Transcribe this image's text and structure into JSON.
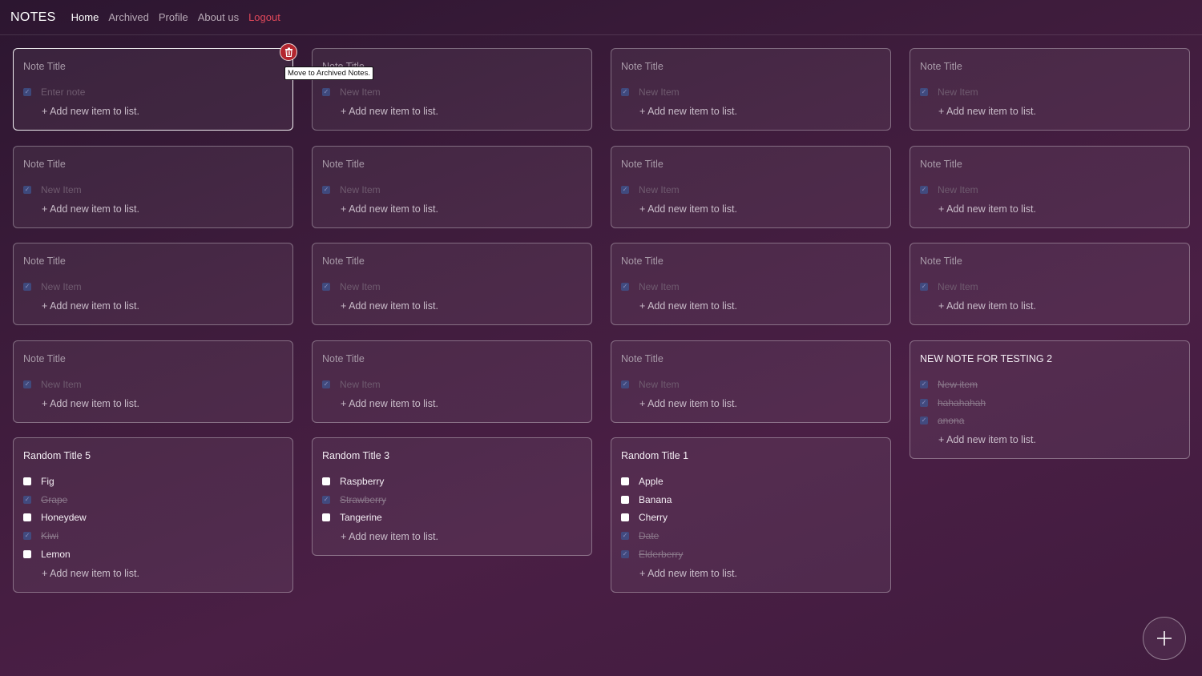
{
  "nav": {
    "brand": "NOTES",
    "links": [
      {
        "label": "Home",
        "active": true
      },
      {
        "label": "Archived"
      },
      {
        "label": "Profile"
      },
      {
        "label": "About us"
      },
      {
        "label": "Logout"
      }
    ]
  },
  "add_item_label": "+ Add new item to list.",
  "tooltip": "Move to Archived Notes.",
  "icons": {
    "delete": "trash-icon",
    "add_note": "plus-icon",
    "check": "check-icon"
  },
  "colors": {
    "logout": "#e0485a",
    "delete_button": "#b3262f",
    "checkbox_checked": "#3d5590"
  },
  "notes": [
    {
      "title": "Note Title",
      "titleSet": false,
      "items": [
        {
          "text": "Enter note",
          "checked": true,
          "placeholder": true
        }
      ]
    },
    {
      "title": "Note Title",
      "titleSet": false,
      "items": [
        {
          "text": "New Item",
          "checked": true,
          "placeholder": true
        }
      ]
    },
    {
      "title": "Note Title",
      "titleSet": false,
      "items": [
        {
          "text": "New Item",
          "checked": true,
          "placeholder": true
        }
      ]
    },
    {
      "title": "Note Title",
      "titleSet": false,
      "items": [
        {
          "text": "New Item",
          "checked": true,
          "placeholder": true
        }
      ]
    },
    {
      "title": "Note Title",
      "titleSet": false,
      "items": [
        {
          "text": "New Item",
          "checked": true,
          "placeholder": true
        }
      ]
    },
    {
      "title": "Note Title",
      "titleSet": false,
      "items": [
        {
          "text": "New Item",
          "checked": true,
          "placeholder": true
        }
      ]
    },
    {
      "title": "Note Title",
      "titleSet": false,
      "items": [
        {
          "text": "New Item",
          "checked": true,
          "placeholder": true
        }
      ]
    },
    {
      "title": "Note Title",
      "titleSet": false,
      "items": [
        {
          "text": "New Item",
          "checked": true,
          "placeholder": true
        }
      ]
    },
    {
      "title": "Note Title",
      "titleSet": false,
      "items": [
        {
          "text": "New Item",
          "checked": true,
          "placeholder": true
        }
      ]
    },
    {
      "title": "Note Title",
      "titleSet": false,
      "items": [
        {
          "text": "New Item",
          "checked": true,
          "placeholder": true
        }
      ]
    },
    {
      "title": "Note Title",
      "titleSet": false,
      "items": [
        {
          "text": "New Item",
          "checked": true,
          "placeholder": true
        }
      ]
    },
    {
      "title": "Note Title",
      "titleSet": false,
      "items": [
        {
          "text": "New Item",
          "checked": true,
          "placeholder": true
        }
      ]
    },
    {
      "title": "Note Title",
      "titleSet": false,
      "items": [
        {
          "text": "New Item",
          "checked": true,
          "placeholder": true
        }
      ]
    },
    {
      "title": "Note Title",
      "titleSet": false,
      "items": [
        {
          "text": "New Item",
          "checked": true,
          "placeholder": true
        }
      ]
    },
    {
      "title": "Note Title",
      "titleSet": false,
      "items": [
        {
          "text": "New Item",
          "checked": true,
          "placeholder": true
        }
      ]
    },
    {
      "title": "NEW NOTE FOR TESTING 2",
      "titleSet": true,
      "items": [
        {
          "text": "New item",
          "checked": true
        },
        {
          "text": "hahahahah",
          "checked": true
        },
        {
          "text": "anona",
          "checked": true
        }
      ]
    },
    {
      "title": "Random Title 5",
      "titleSet": true,
      "items": [
        {
          "text": "Fig",
          "checked": false
        },
        {
          "text": "Grape",
          "checked": true
        },
        {
          "text": "Honeydew",
          "checked": false
        },
        {
          "text": "Kiwi",
          "checked": true
        },
        {
          "text": "Lemon",
          "checked": false
        }
      ]
    },
    {
      "title": "Random Title 3",
      "titleSet": true,
      "items": [
        {
          "text": "Raspberry",
          "checked": false
        },
        {
          "text": "Strawberry",
          "checked": true
        },
        {
          "text": "Tangerine",
          "checked": false
        }
      ]
    },
    {
      "title": "Random Title 1",
      "titleSet": true,
      "items": [
        {
          "text": "Apple",
          "checked": false
        },
        {
          "text": "Banana",
          "checked": false
        },
        {
          "text": "Cherry",
          "checked": false
        },
        {
          "text": "Date",
          "checked": true
        },
        {
          "text": "Elderberry",
          "checked": true
        }
      ]
    }
  ]
}
